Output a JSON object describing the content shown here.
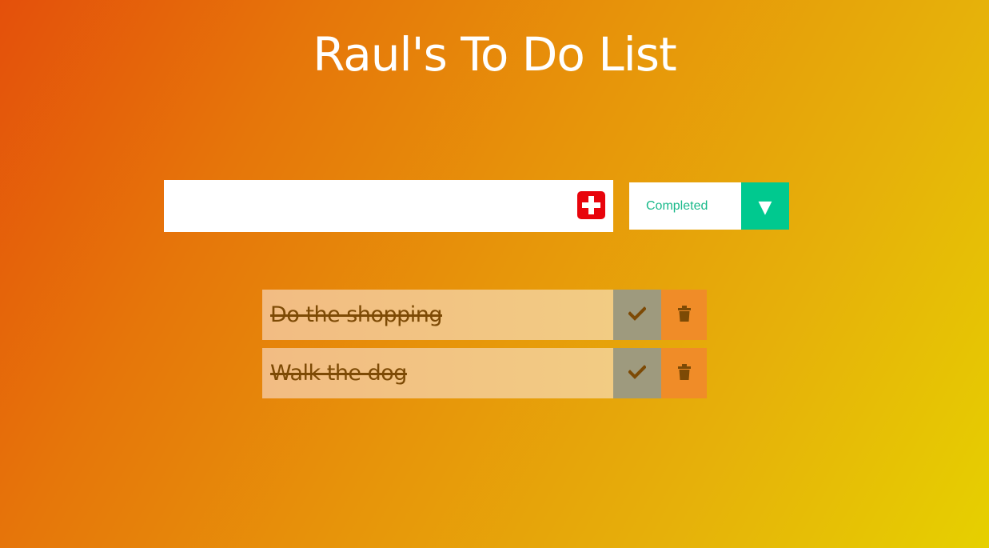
{
  "header": {
    "title": "Raul's To Do List"
  },
  "form": {
    "input_value": "",
    "input_placeholder": "",
    "add_icon": "plus-icon",
    "add_color": "#e8040c"
  },
  "filter": {
    "selected": "Completed",
    "arrow_glyph": "▼",
    "accent_color": "#00c98f"
  },
  "todos": [
    {
      "text": "Do the shopping",
      "completed": true
    },
    {
      "text": "Walk the dog",
      "completed": true
    }
  ]
}
